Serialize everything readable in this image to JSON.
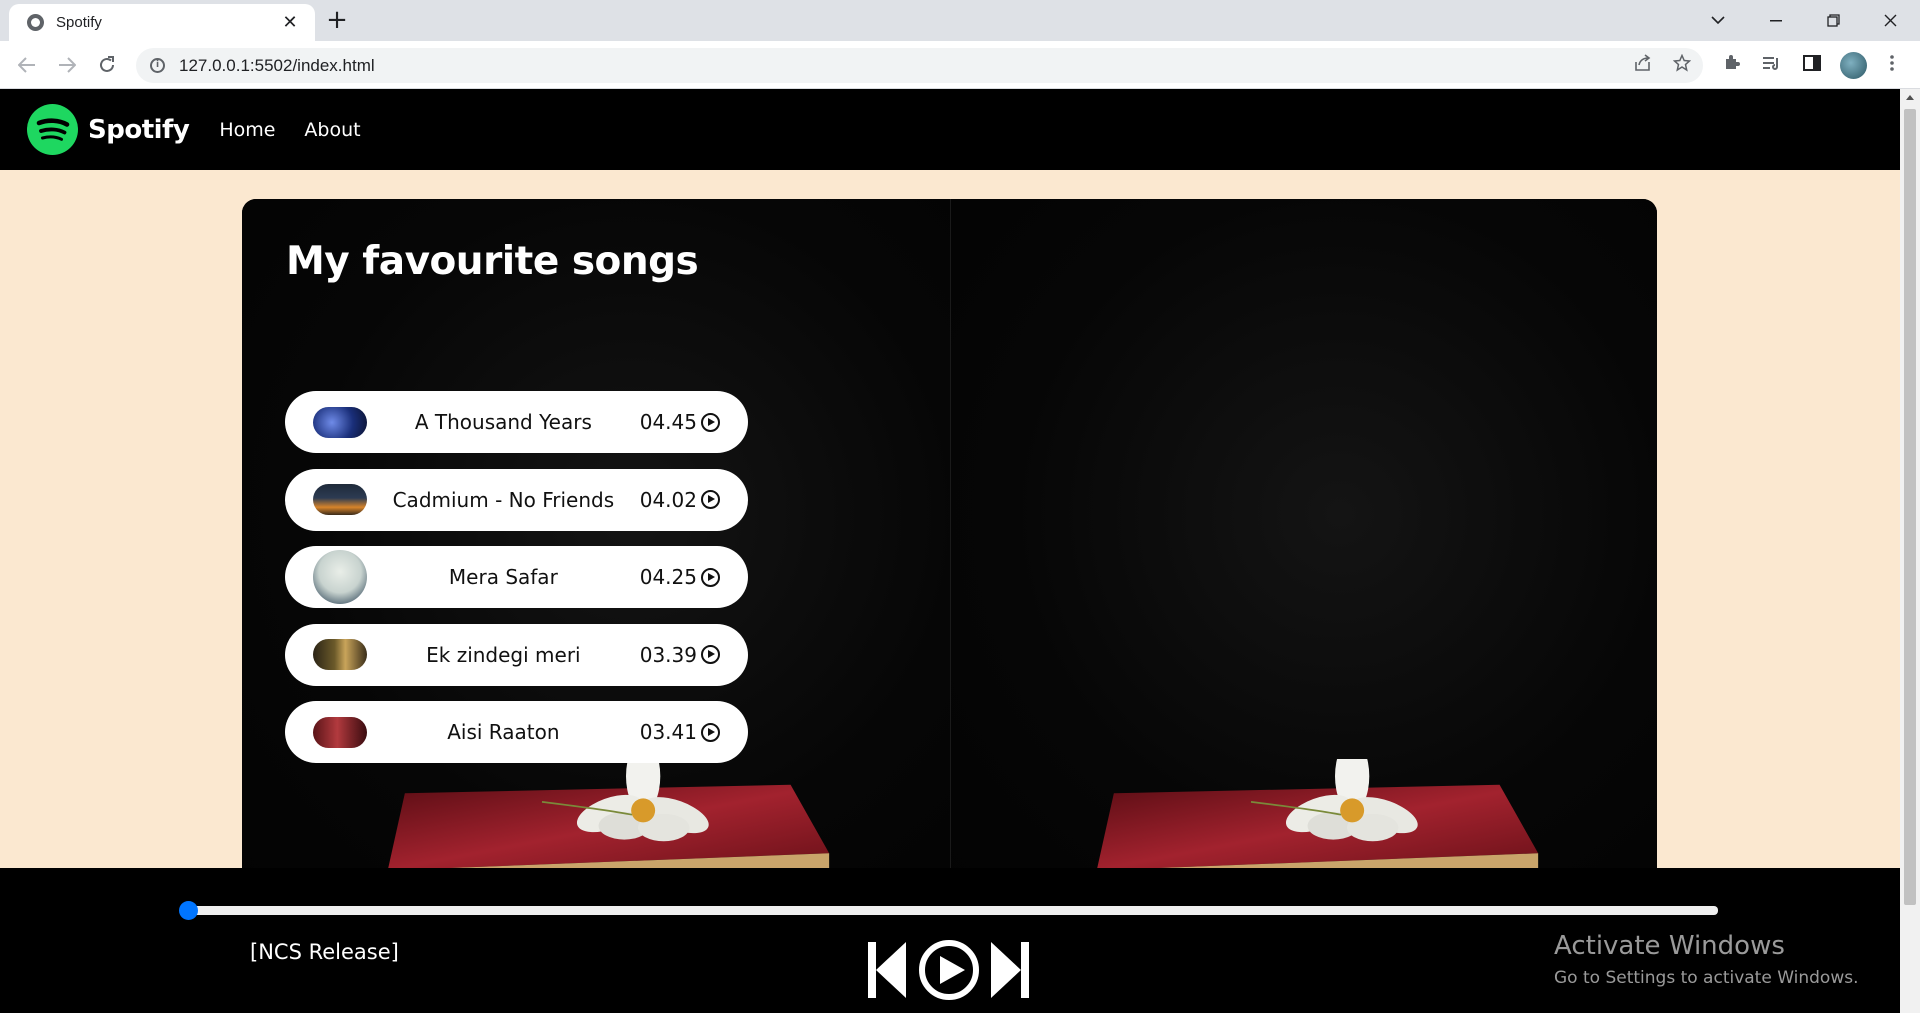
{
  "browser": {
    "tab_title": "Spotify",
    "tab_close": "✕",
    "new_tab": "+",
    "url": "127.0.0.1:5502/index.html"
  },
  "site": {
    "brand": "Spotify",
    "nav": [
      "Home",
      "About"
    ]
  },
  "card": {
    "title": "My favourite songs",
    "songs": [
      {
        "name": "A Thousand Years",
        "duration": "04.45"
      },
      {
        "name": "Cadmium - No Friends",
        "duration": "04.02"
      },
      {
        "name": "Mera Safar",
        "duration": "04.25"
      },
      {
        "name": "Ek zindegi meri",
        "duration": "03.39"
      },
      {
        "name": "Aisi Raaton",
        "duration": "03.41"
      }
    ]
  },
  "player": {
    "now_playing": "[NCS Release]",
    "progress": 0
  },
  "watermark": {
    "title": "Activate Windows",
    "subtitle": "Go to Settings to activate Windows."
  },
  "colors": {
    "spotify_green": "#1ed760",
    "page_bg": "#fbe8d0",
    "progress_accent": "#0075ff"
  },
  "icons": [
    "globe-icon",
    "back-icon",
    "forward-icon",
    "reload-icon",
    "info-icon",
    "share-icon",
    "star-icon",
    "extensions-icon",
    "media-icon",
    "sidepanel-icon",
    "menu-icon",
    "previous-icon",
    "play-icon",
    "next-icon"
  ]
}
